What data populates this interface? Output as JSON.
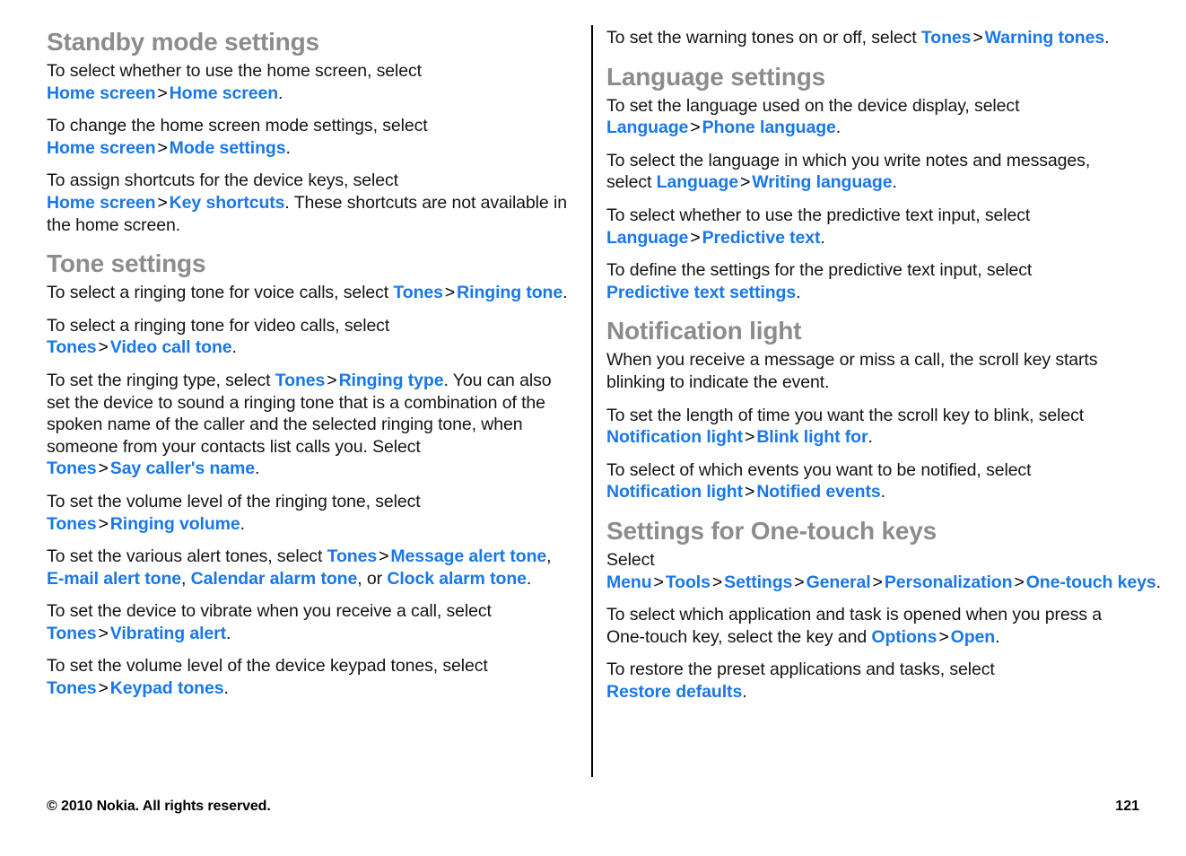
{
  "document": {
    "page_number": "121",
    "footer_copyright": "© 2010 Nokia. All rights reserved."
  },
  "colors": {
    "link_blue": "#1a78e6",
    "heading_gray": "#8c8c8c",
    "body_black": "#141414",
    "divider": "#000000",
    "background": "#ffffff"
  },
  "left_column": {
    "sections": [
      {
        "heading": "Standby mode settings",
        "paragraphs": [
          {
            "parts": [
              {
                "type": "text",
                "value": "To select whether to use the home screen, select "
              },
              {
                "type": "link",
                "value": "Home screen"
              },
              {
                "type": "sep",
                "value": ">"
              },
              {
                "type": "link",
                "value": "Home screen"
              },
              {
                "type": "text",
                "value": "."
              }
            ]
          },
          {
            "parts": [
              {
                "type": "text",
                "value": "To change the home screen mode settings, select "
              },
              {
                "type": "link",
                "value": "Home screen"
              },
              {
                "type": "sep",
                "value": ">"
              },
              {
                "type": "link",
                "value": "Mode settings"
              },
              {
                "type": "text",
                "value": "."
              }
            ]
          },
          {
            "parts": [
              {
                "type": "text",
                "value": "To assign shortcuts for the device keys, select "
              },
              {
                "type": "link",
                "value": "Home screen"
              },
              {
                "type": "sep",
                "value": ">"
              },
              {
                "type": "link",
                "value": "Key shortcuts"
              },
              {
                "type": "text",
                "value": ". These shortcuts are not available in the home screen."
              }
            ]
          }
        ]
      },
      {
        "heading": "Tone settings",
        "paragraphs": [
          {
            "parts": [
              {
                "type": "text",
                "value": "To select a ringing tone for voice calls, select "
              },
              {
                "type": "link",
                "value": "Tones"
              },
              {
                "type": "sep",
                "value": ">"
              },
              {
                "type": "link",
                "value": "Ringing tone"
              },
              {
                "type": "text",
                "value": "."
              }
            ]
          },
          {
            "parts": [
              {
                "type": "text",
                "value": "To select a ringing tone for video calls, select "
              },
              {
                "type": "link",
                "value": "Tones"
              },
              {
                "type": "sep",
                "value": ">"
              },
              {
                "type": "link",
                "value": "Video call tone"
              },
              {
                "type": "text",
                "value": "."
              }
            ]
          },
          {
            "parts": [
              {
                "type": "text",
                "value": "To set the ringing type, select "
              },
              {
                "type": "link",
                "value": "Tones"
              },
              {
                "type": "sep",
                "value": ">"
              },
              {
                "type": "link",
                "value": "Ringing type"
              },
              {
                "type": "text",
                "value": ". You can also set the device to sound a ringing tone that is a combination of the spoken name of the caller and the selected ringing tone, when someone from your contacts list calls you. Select "
              },
              {
                "type": "link",
                "value": "Tones"
              },
              {
                "type": "sep",
                "value": ">"
              },
              {
                "type": "link",
                "value": "Say caller's name"
              },
              {
                "type": "text",
                "value": "."
              }
            ]
          },
          {
            "parts": [
              {
                "type": "text",
                "value": "To set the volume level of the ringing tone, select "
              },
              {
                "type": "link",
                "value": "Tones"
              },
              {
                "type": "sep",
                "value": ">"
              },
              {
                "type": "link",
                "value": "Ringing volume"
              },
              {
                "type": "text",
                "value": "."
              }
            ]
          },
          {
            "parts": [
              {
                "type": "text",
                "value": "To set the various alert tones, select "
              },
              {
                "type": "link",
                "value": "Tones"
              },
              {
                "type": "sep",
                "value": ">"
              },
              {
                "type": "link",
                "value": "Message alert tone"
              },
              {
                "type": "text",
                "value": ", "
              },
              {
                "type": "link",
                "value": "E-mail alert tone"
              },
              {
                "type": "text",
                "value": ", "
              },
              {
                "type": "link",
                "value": "Calendar alarm tone"
              },
              {
                "type": "text",
                "value": ", or "
              },
              {
                "type": "link",
                "value": "Clock alarm tone"
              },
              {
                "type": "text",
                "value": "."
              }
            ]
          },
          {
            "parts": [
              {
                "type": "text",
                "value": "To set the device to vibrate when you receive a call, select "
              },
              {
                "type": "link",
                "value": "Tones"
              },
              {
                "type": "sep",
                "value": ">"
              },
              {
                "type": "link",
                "value": "Vibrating alert"
              },
              {
                "type": "text",
                "value": "."
              }
            ]
          },
          {
            "parts": [
              {
                "type": "text",
                "value": "To set the volume level of the device keypad tones, select "
              },
              {
                "type": "link",
                "value": "Tones"
              },
              {
                "type": "sep",
                "value": ">"
              },
              {
                "type": "link",
                "value": "Keypad tones"
              },
              {
                "type": "text",
                "value": "."
              }
            ]
          }
        ]
      }
    ]
  },
  "right_column": {
    "sections": [
      {
        "heading": null,
        "paragraphs": [
          {
            "parts": [
              {
                "type": "text",
                "value": "To set the warning tones on or off, select "
              },
              {
                "type": "link",
                "value": "Tones"
              },
              {
                "type": "sep",
                "value": ">"
              },
              {
                "type": "link",
                "value": "Warning tones"
              },
              {
                "type": "text",
                "value": "."
              }
            ]
          }
        ]
      },
      {
        "heading": "Language settings",
        "paragraphs": [
          {
            "parts": [
              {
                "type": "text",
                "value": "To set the language used on the device display, select "
              },
              {
                "type": "link",
                "value": "Language"
              },
              {
                "type": "sep",
                "value": ">"
              },
              {
                "type": "link",
                "value": "Phone language"
              },
              {
                "type": "text",
                "value": "."
              }
            ]
          },
          {
            "parts": [
              {
                "type": "text",
                "value": "To select the language in which you write notes and messages, select "
              },
              {
                "type": "link",
                "value": "Language"
              },
              {
                "type": "sep",
                "value": ">"
              },
              {
                "type": "link",
                "value": "Writing language"
              },
              {
                "type": "text",
                "value": "."
              }
            ]
          },
          {
            "parts": [
              {
                "type": "text",
                "value": "To select whether to use the predictive text input, select "
              },
              {
                "type": "link",
                "value": "Language"
              },
              {
                "type": "sep",
                "value": ">"
              },
              {
                "type": "link",
                "value": "Predictive text"
              },
              {
                "type": "text",
                "value": "."
              }
            ]
          },
          {
            "parts": [
              {
                "type": "text",
                "value": "To define the settings for the predictive text input, select "
              },
              {
                "type": "link",
                "value": "Predictive text settings"
              },
              {
                "type": "text",
                "value": "."
              }
            ]
          }
        ]
      },
      {
        "heading": "Notification light",
        "paragraphs": [
          {
            "parts": [
              {
                "type": "text",
                "value": "When you receive a message or miss a call, the scroll key starts blinking to indicate the event."
              }
            ]
          },
          {
            "parts": [
              {
                "type": "text",
                "value": "To set the length of time you want the scroll key to blink, select "
              },
              {
                "type": "link",
                "value": "Notification light"
              },
              {
                "type": "sep",
                "value": ">"
              },
              {
                "type": "link",
                "value": "Blink light for"
              },
              {
                "type": "text",
                "value": "."
              }
            ]
          },
          {
            "parts": [
              {
                "type": "text",
                "value": "To select of which events you want to be notified, select "
              },
              {
                "type": "link",
                "value": "Notification light"
              },
              {
                "type": "sep",
                "value": ">"
              },
              {
                "type": "link",
                "value": "Notified events"
              },
              {
                "type": "text",
                "value": "."
              }
            ]
          }
        ]
      },
      {
        "heading": "Settings for One-touch keys",
        "paragraphs": [
          {
            "parts": [
              {
                "type": "text",
                "value": "Select "
              },
              {
                "type": "link",
                "value": "Menu"
              },
              {
                "type": "sep",
                "value": ">"
              },
              {
                "type": "link",
                "value": "Tools"
              },
              {
                "type": "sep",
                "value": ">"
              },
              {
                "type": "link",
                "value": "Settings"
              },
              {
                "type": "sep",
                "value": ">"
              },
              {
                "type": "link",
                "value": "General"
              },
              {
                "type": "sep",
                "value": ">"
              },
              {
                "type": "link",
                "value": "Personalization"
              },
              {
                "type": "sep",
                "value": ">"
              },
              {
                "type": "link",
                "value": "One-touch keys"
              },
              {
                "type": "text",
                "value": "."
              }
            ]
          },
          {
            "parts": [
              {
                "type": "text",
                "value": "To select which application and task is opened when you press a One-touch key, select the key and "
              },
              {
                "type": "link",
                "value": "Options"
              },
              {
                "type": "sep",
                "value": ">"
              },
              {
                "type": "link",
                "value": "Open"
              },
              {
                "type": "text",
                "value": "."
              }
            ]
          },
          {
            "parts": [
              {
                "type": "text",
                "value": "To restore the preset applications and tasks, select "
              },
              {
                "type": "link",
                "value": "Restore defaults"
              },
              {
                "type": "text",
                "value": "."
              }
            ]
          }
        ]
      }
    ]
  }
}
